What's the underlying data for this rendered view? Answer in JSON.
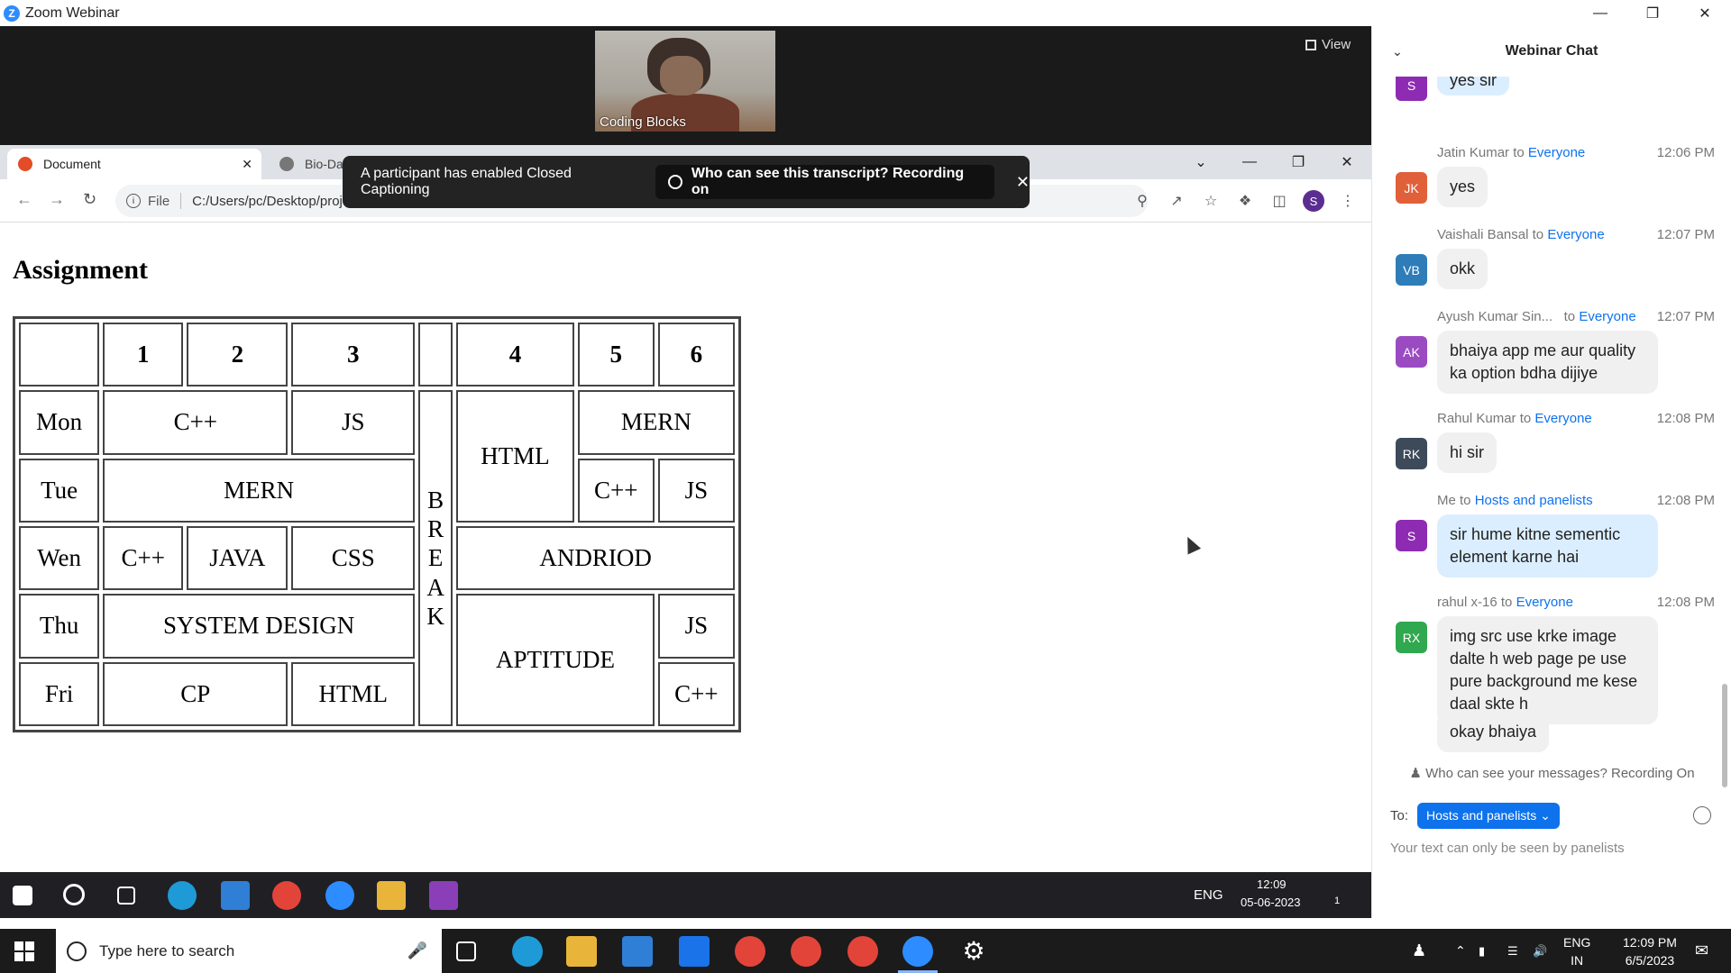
{
  "zoom": {
    "title": "Zoom Webinar",
    "view_label": "View",
    "speaker_name": "Coding Blocks"
  },
  "browser": {
    "tabs": [
      {
        "label": "Document",
        "active": true
      },
      {
        "label": "Bio-Data Form",
        "active": false
      }
    ],
    "scheme": "File",
    "url": "C:/Users/pc/Desktop/project/HTML/tableAssignment.html"
  },
  "cc_toast": {
    "message": "A participant has enabled Closed Captioning",
    "pill": "Who can see this transcript? Recording on"
  },
  "page": {
    "heading": "Assignment",
    "table": {
      "header": [
        "",
        "1",
        "2",
        "3",
        "",
        "4",
        "5",
        "6"
      ],
      "rows": {
        "mon": {
          "day": "Mon",
          "c1": "C++",
          "c3": "JS",
          "c4": "HTML",
          "c5": "MERN"
        },
        "tue": {
          "day": "Tue",
          "c1": "MERN",
          "c5": "C++",
          "c6": "JS"
        },
        "wen": {
          "day": "Wen",
          "c1": "C++",
          "c2": "JAVA",
          "c3": "CSS",
          "c4": "ANDRIOD"
        },
        "thu": {
          "day": "Thu",
          "c1": "SYSTEM DESIGN",
          "c4": "APTITUDE",
          "c6": "JS"
        },
        "fri": {
          "day": "Fri",
          "c1": "CP",
          "c3": "HTML",
          "c6": "C++"
        }
      },
      "break_letters": [
        "B",
        "R",
        "E",
        "A",
        "K"
      ]
    }
  },
  "inner_taskbar": {
    "time": "12:09",
    "date": "05-06-2023",
    "lang": "ENG",
    "notif_count": "1"
  },
  "chat": {
    "title": "Webinar Chat",
    "to_word": "to",
    "messages": [
      {
        "initials": "S",
        "color": "#8e2bb3",
        "name": "",
        "target": "",
        "time": "",
        "text": "yes sir",
        "me": true
      },
      {
        "initials": "JK",
        "color": "#e0603a",
        "name": "Jatin Kumar",
        "target": "Everyone",
        "time": "12:06 PM",
        "text": "yes"
      },
      {
        "initials": "VB",
        "color": "#2e7db8",
        "name": "Vaishali Bansal",
        "target": "Everyone",
        "time": "12:07 PM",
        "text": "okk"
      },
      {
        "initials": "AK",
        "color": "#9b4bc2",
        "name": "Ayush Kumar Sin...",
        "target": "Everyone",
        "time": "12:07 PM",
        "text": "bhaiya app me aur quality ka option bdha dijiye"
      },
      {
        "initials": "RK",
        "color": "#3d4a5a",
        "name": "Rahul Kumar",
        "target": "Everyone",
        "time": "12:08 PM",
        "text": "hi sir"
      },
      {
        "initials": "S",
        "color": "#8e2bb3",
        "name": "Me",
        "target": "Hosts and panelists",
        "time": "12:08 PM",
        "text": "sir hume kitne sementic element karne hai",
        "me": true
      },
      {
        "initials": "RX",
        "color": "#2fa84f",
        "name": "rahul x-16",
        "target": "Everyone",
        "time": "12:08 PM",
        "text": "img src use krke image dalte h web page pe use pure background me kese daal skte h"
      },
      {
        "initials": "",
        "color": "",
        "name": "",
        "target": "",
        "time": "",
        "text": "okay bhaiya"
      }
    ],
    "recording_note": "Who can see your messages? Recording On",
    "to_label": "To:",
    "to_value": "Hosts and panelists",
    "hint": "Your text can only be seen by panelists"
  },
  "taskbar": {
    "search_placeholder": "Type here to search",
    "lang_top": "ENG",
    "lang_bottom": "IN",
    "time": "12:09 PM",
    "date": "6/5/2023"
  }
}
